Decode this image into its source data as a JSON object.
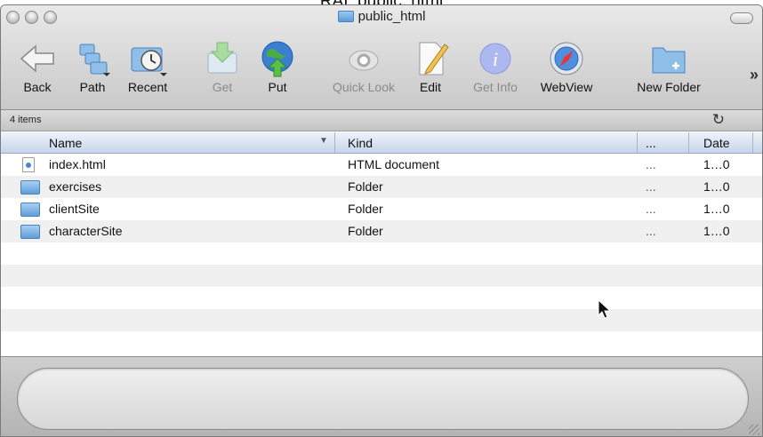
{
  "screen_caption": "RAI: public_html",
  "window": {
    "title": "public_html"
  },
  "toolbar": {
    "items": [
      {
        "label": "Back",
        "icon": "back-arrow-icon",
        "enabled": true
      },
      {
        "label": "Path",
        "icon": "path-icon",
        "enabled": true
      },
      {
        "label": "Recent",
        "icon": "recent-icon",
        "enabled": true
      },
      {
        "label": "Get",
        "icon": "get-icon",
        "enabled": false
      },
      {
        "label": "Put",
        "icon": "put-icon",
        "enabled": true
      },
      {
        "label": "Quick Look",
        "icon": "quick-look-icon",
        "enabled": false
      },
      {
        "label": "Edit",
        "icon": "edit-icon",
        "enabled": true
      },
      {
        "label": "Get Info",
        "icon": "get-info-icon",
        "enabled": false
      },
      {
        "label": "WebView",
        "icon": "webview-icon",
        "enabled": true
      },
      {
        "label": "New Folder",
        "icon": "new-folder-icon",
        "enabled": true
      }
    ],
    "overflow": "»"
  },
  "status": {
    "item_count": "4 items",
    "refresh_icon": "↻"
  },
  "table": {
    "columns": [
      "Name",
      "Kind",
      "...",
      "Date"
    ],
    "rows": [
      {
        "name": "index.html",
        "kind": "HTML document",
        "extra": "...",
        "date": "1…0",
        "type": "file"
      },
      {
        "name": "exercises",
        "kind": "Folder",
        "extra": "...",
        "date": "1…0",
        "type": "folder"
      },
      {
        "name": "clientSite",
        "kind": "Folder",
        "extra": "...",
        "date": "1…0",
        "type": "folder"
      },
      {
        "name": "characterSite",
        "kind": "Folder",
        "extra": "...",
        "date": "1…0",
        "type": "folder"
      }
    ]
  },
  "colors": {
    "header_bg": "#c7d4ea",
    "folder_blue": "#5f9dd8",
    "toolbar_bg": "#d6d6d6"
  }
}
